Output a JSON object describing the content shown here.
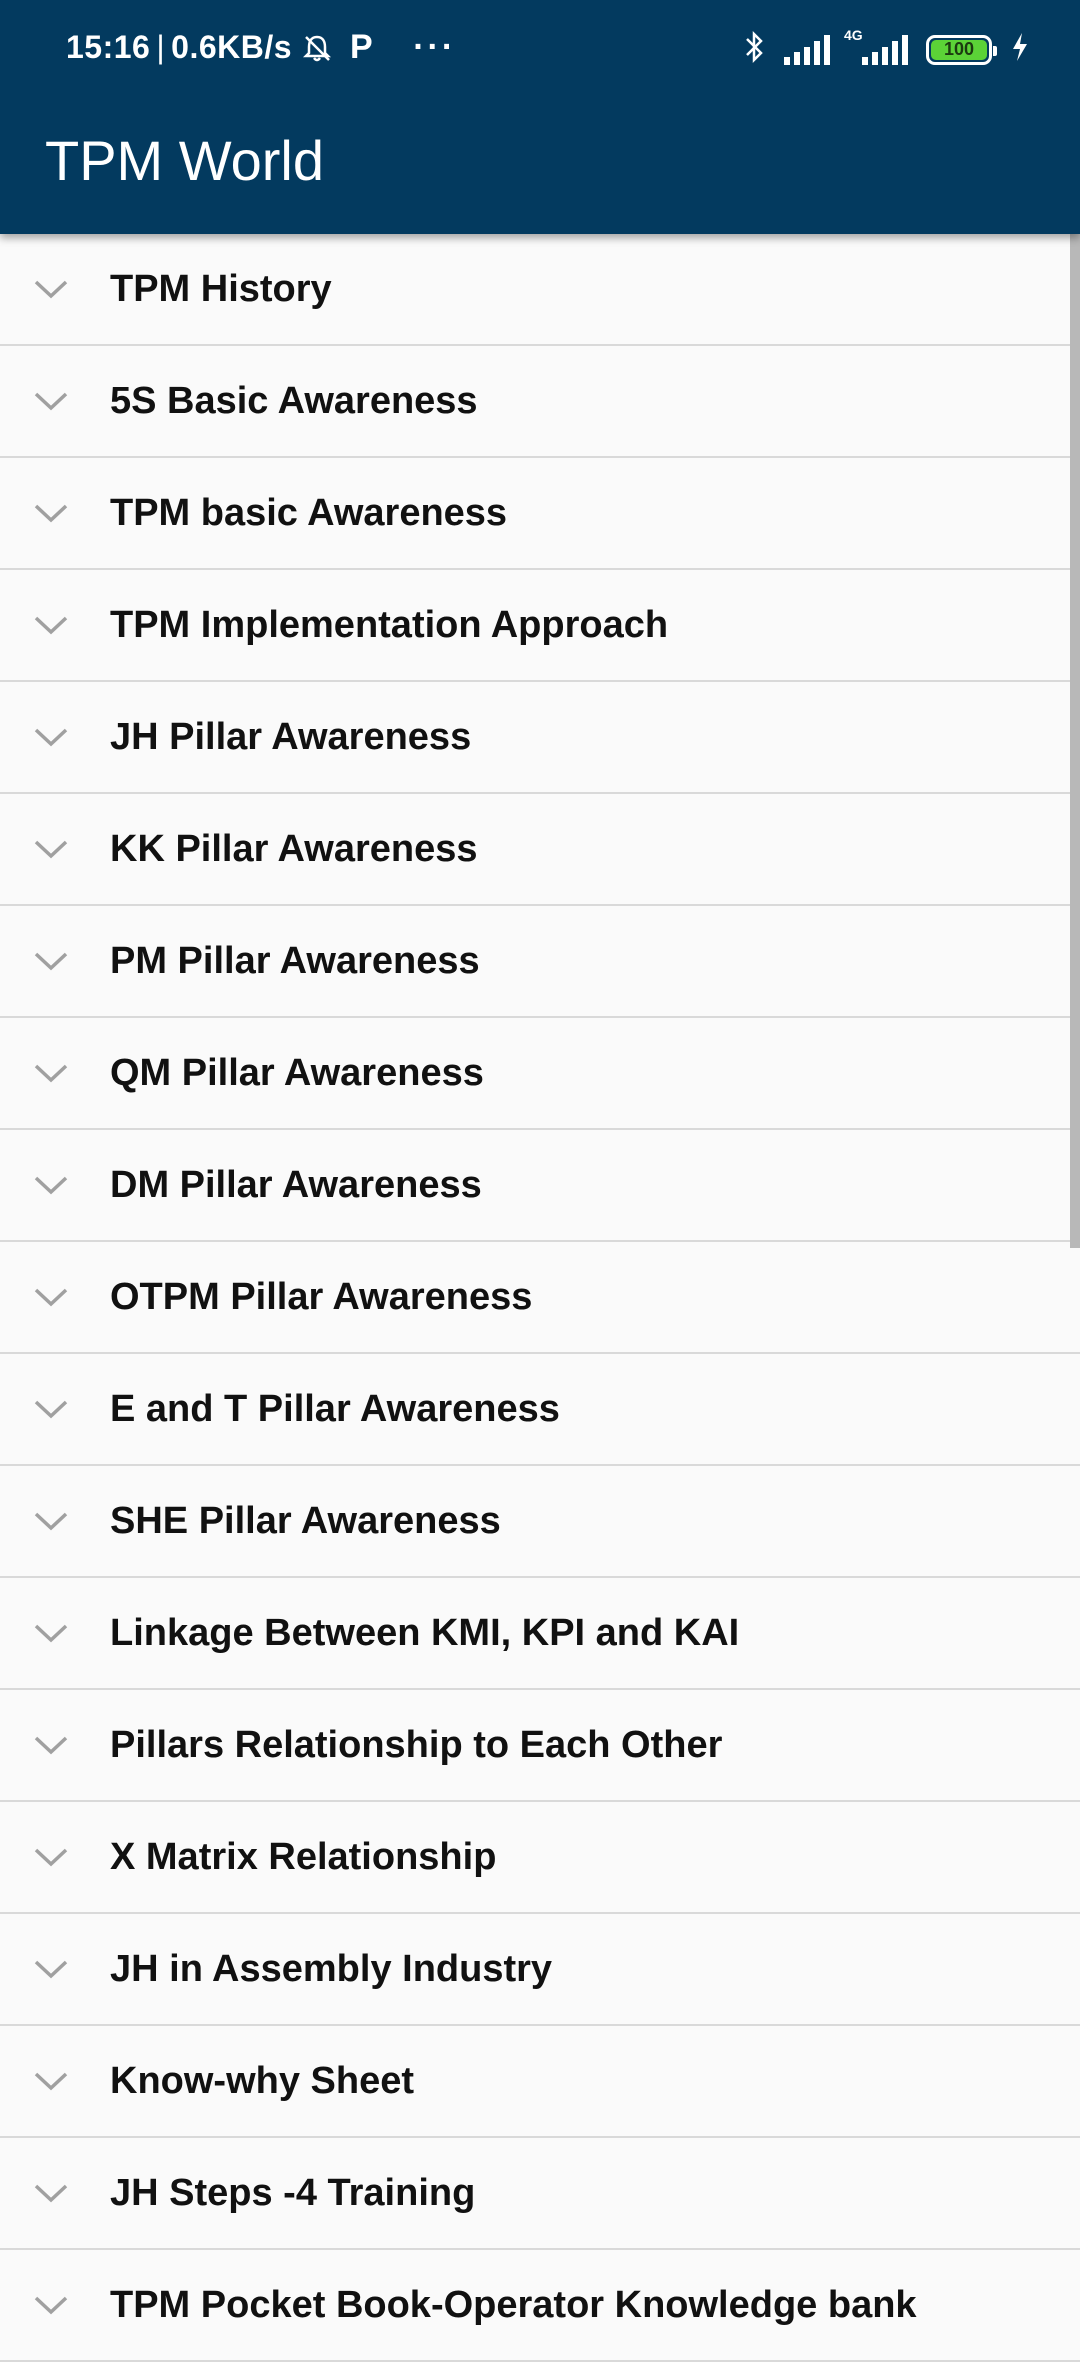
{
  "status_bar": {
    "time": "15:16",
    "network_speed": "0.6KB/s",
    "network_type": "4G",
    "battery_level": "100",
    "icons": [
      "alarm-off-icon",
      "p-app-icon",
      "more-dots-icon",
      "bluetooth-icon",
      "signal-icon",
      "4g-signal-icon",
      "battery-icon",
      "charging-icon"
    ]
  },
  "app": {
    "title": "TPM World",
    "header_color": "#033a5f"
  },
  "topics": [
    {
      "label": "TPM History"
    },
    {
      "label": "5S Basic Awareness"
    },
    {
      "label": "TPM basic Awareness"
    },
    {
      "label": "TPM Implementation Approach"
    },
    {
      "label": "JH Pillar Awareness"
    },
    {
      "label": "KK Pillar Awareness"
    },
    {
      "label": "PM Pillar Awareness"
    },
    {
      "label": "QM Pillar Awareness"
    },
    {
      "label": "DM Pillar Awareness"
    },
    {
      "label": "OTPM Pillar Awareness"
    },
    {
      "label": "E and T Pillar Awareness"
    },
    {
      "label": "SHE Pillar Awareness"
    },
    {
      "label": "Linkage Between KMI, KPI and KAI"
    },
    {
      "label": "Pillars Relationship to Each Other"
    },
    {
      "label": "X Matrix Relationship"
    },
    {
      "label": "JH in Assembly Industry"
    },
    {
      "label": "Know-why Sheet"
    },
    {
      "label": "JH Steps -4 Training"
    },
    {
      "label": "TPM Pocket Book-Operator Knowledge bank"
    }
  ]
}
